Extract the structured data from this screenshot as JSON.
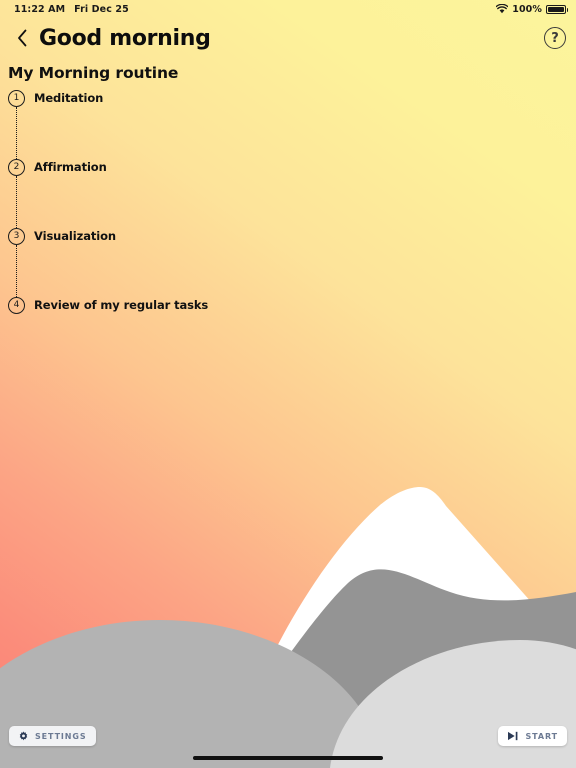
{
  "status_bar": {
    "time": "11:22 AM",
    "date": "Fri Dec 25",
    "wifi_icon": "wifi-icon",
    "battery_percent": "100%",
    "battery_icon": "battery-full-icon"
  },
  "header": {
    "back_icon": "chevron-left-icon",
    "title": "Good morning",
    "help_icon": "help-circle-icon",
    "help_glyph": "?"
  },
  "routine": {
    "title": "My Morning routine",
    "steps": [
      {
        "number": "1",
        "label": "Meditation"
      },
      {
        "number": "2",
        "label": "Affirmation"
      },
      {
        "number": "3",
        "label": "Visualization"
      },
      {
        "number": "4",
        "label": "Review of my regular tasks"
      }
    ]
  },
  "controls": {
    "settings_label": "SETTINGS",
    "settings_icon": "gear-icon",
    "start_label": "START",
    "start_icon": "play-skip-icon"
  },
  "colors": {
    "gradient_top_right": "#FCF49C",
    "gradient_bottom_left": "#FA7F74",
    "mountain_main": "#949494",
    "mountain_left": "#B3B3B3",
    "mountain_right": "#DCDCDC",
    "snow_cap": "#FFFFFF",
    "text_primary": "#111111",
    "button_text": "#6C7A93",
    "icon_navy": "#2B3A55"
  }
}
